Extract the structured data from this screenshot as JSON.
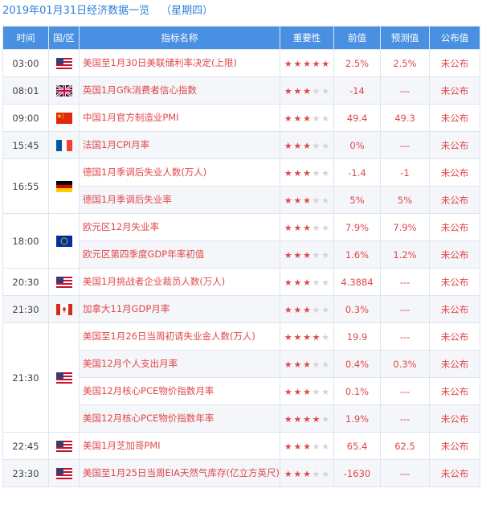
{
  "header": {
    "date_title": "2019年01月31日经济数据一览",
    "weekday": "（星期四）"
  },
  "columns": {
    "time": "时间",
    "region": "国/区",
    "name": "指标名称",
    "importance": "重要性",
    "previous": "前值",
    "forecast": "预测值",
    "actual": "公布值"
  },
  "groups": [
    {
      "time": "03:00",
      "flag": "us-flag-icon",
      "rows": [
        {
          "name": "美国至1月30日美联储利率决定(上限)",
          "stars": 5,
          "previous": "2.5%",
          "forecast": "2.5%",
          "actual": "未公布"
        }
      ]
    },
    {
      "time": "08:01",
      "flag": "uk-flag-icon",
      "rows": [
        {
          "name": "英国1月Gfk消费者信心指数",
          "stars": 3,
          "previous": "-14",
          "forecast": "---",
          "actual": "未公布"
        }
      ]
    },
    {
      "time": "09:00",
      "flag": "cn-flag-icon",
      "rows": [
        {
          "name": "中国1月官方制造业PMI",
          "stars": 3,
          "previous": "49.4",
          "forecast": "49.3",
          "actual": "未公布"
        }
      ]
    },
    {
      "time": "15:45",
      "flag": "fr-flag-icon",
      "rows": [
        {
          "name": "法国1月CPI月率",
          "stars": 3,
          "previous": "0%",
          "forecast": "---",
          "actual": "未公布"
        }
      ]
    },
    {
      "time": "16:55",
      "flag": "de-flag-icon",
      "rows": [
        {
          "name": "德国1月季调后失业人数(万人)",
          "stars": 3,
          "previous": "-1.4",
          "forecast": "-1",
          "actual": "未公布"
        },
        {
          "name": "德国1月季调后失业率",
          "stars": 3,
          "previous": "5%",
          "forecast": "5%",
          "actual": "未公布"
        }
      ]
    },
    {
      "time": "18:00",
      "flag": "eu-flag-icon",
      "rows": [
        {
          "name": "欧元区12月失业率",
          "stars": 3,
          "previous": "7.9%",
          "forecast": "7.9%",
          "actual": "未公布"
        },
        {
          "name": "欧元区第四季度GDP年率初值",
          "stars": 3,
          "previous": "1.6%",
          "forecast": "1.2%",
          "actual": "未公布"
        }
      ]
    },
    {
      "time": "20:30",
      "flag": "us-flag-icon",
      "rows": [
        {
          "name": "美国1月挑战者企业裁员人数(万人)",
          "stars": 3,
          "previous": "4.3884",
          "forecast": "---",
          "actual": "未公布"
        }
      ]
    },
    {
      "time": "21:30",
      "flag": "ca-flag-icon",
      "rows": [
        {
          "name": "加拿大11月GDP月率",
          "stars": 3,
          "previous": "0.3%",
          "forecast": "---",
          "actual": "未公布"
        }
      ]
    },
    {
      "time": "21:30",
      "flag": "us-flag-icon",
      "rows": [
        {
          "name": "美国至1月26日当周初请失业金人数(万人)",
          "stars": 4,
          "previous": "19.9",
          "forecast": "---",
          "actual": "未公布"
        },
        {
          "name": "美国12月个人支出月率",
          "stars": 3,
          "previous": "0.4%",
          "forecast": "0.3%",
          "actual": "未公布"
        },
        {
          "name": "美国12月核心PCE物价指数月率",
          "stars": 3,
          "previous": "0.1%",
          "forecast": "---",
          "actual": "未公布"
        },
        {
          "name": "美国12月核心PCE物价指数年率",
          "stars": 4,
          "previous": "1.9%",
          "forecast": "---",
          "actual": "未公布"
        }
      ]
    },
    {
      "time": "22:45",
      "flag": "us-flag-icon",
      "rows": [
        {
          "name": "美国1月芝加哥PMI",
          "stars": 3,
          "previous": "65.4",
          "forecast": "62.5",
          "actual": "未公布"
        }
      ]
    },
    {
      "time": "23:30",
      "flag": "us-flag-icon",
      "rows": [
        {
          "name": "美国至1月25日当周EIA天然气库存(亿立方英尺)",
          "stars": 3,
          "previous": "-1630",
          "forecast": "---",
          "actual": "未公布"
        }
      ]
    }
  ]
}
